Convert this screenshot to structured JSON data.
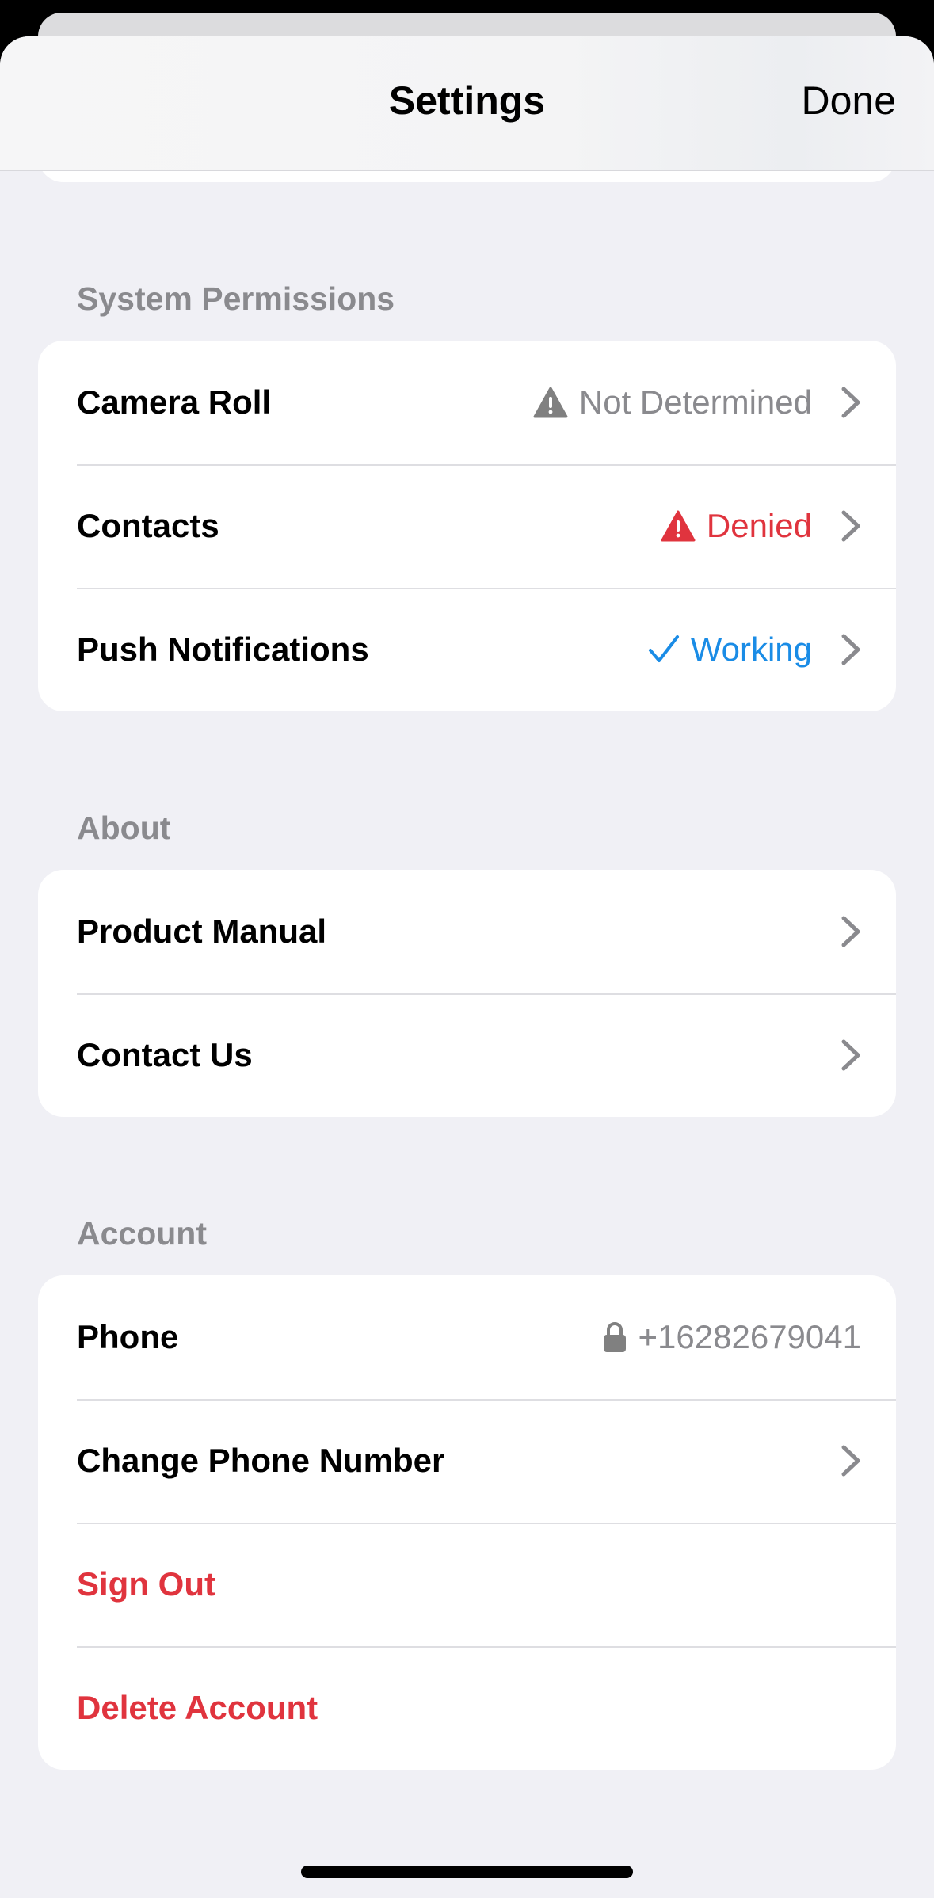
{
  "nav": {
    "title": "Settings",
    "done_label": "Done"
  },
  "sections": {
    "permissions": {
      "header": "System Permissions",
      "camera_roll": {
        "label": "Camera Roll",
        "status": "Not Determined"
      },
      "contacts": {
        "label": "Contacts",
        "status": "Denied"
      },
      "push": {
        "label": "Push Notifications",
        "status": "Working"
      }
    },
    "about": {
      "header": "About",
      "manual": {
        "label": "Product Manual"
      },
      "contact_us": {
        "label": "Contact Us"
      }
    },
    "account": {
      "header": "Account",
      "phone": {
        "label": "Phone",
        "value": "+16282679041"
      },
      "change_phone": {
        "label": "Change Phone Number"
      },
      "sign_out": {
        "label": "Sign Out"
      },
      "delete": {
        "label": "Delete Account"
      }
    }
  },
  "colors": {
    "background": "#f0f0f5",
    "secondary_text": "#8a8a8e",
    "destructive": "#e0343e",
    "success": "#1a8ce6",
    "warning_gray": "#808080"
  },
  "icons": {
    "camera_roll_status": "warning-triangle-icon",
    "contacts_status": "warning-triangle-icon",
    "push_status": "checkmark-icon",
    "phone_lock": "lock-icon",
    "disclosure": "chevron-right-icon"
  }
}
